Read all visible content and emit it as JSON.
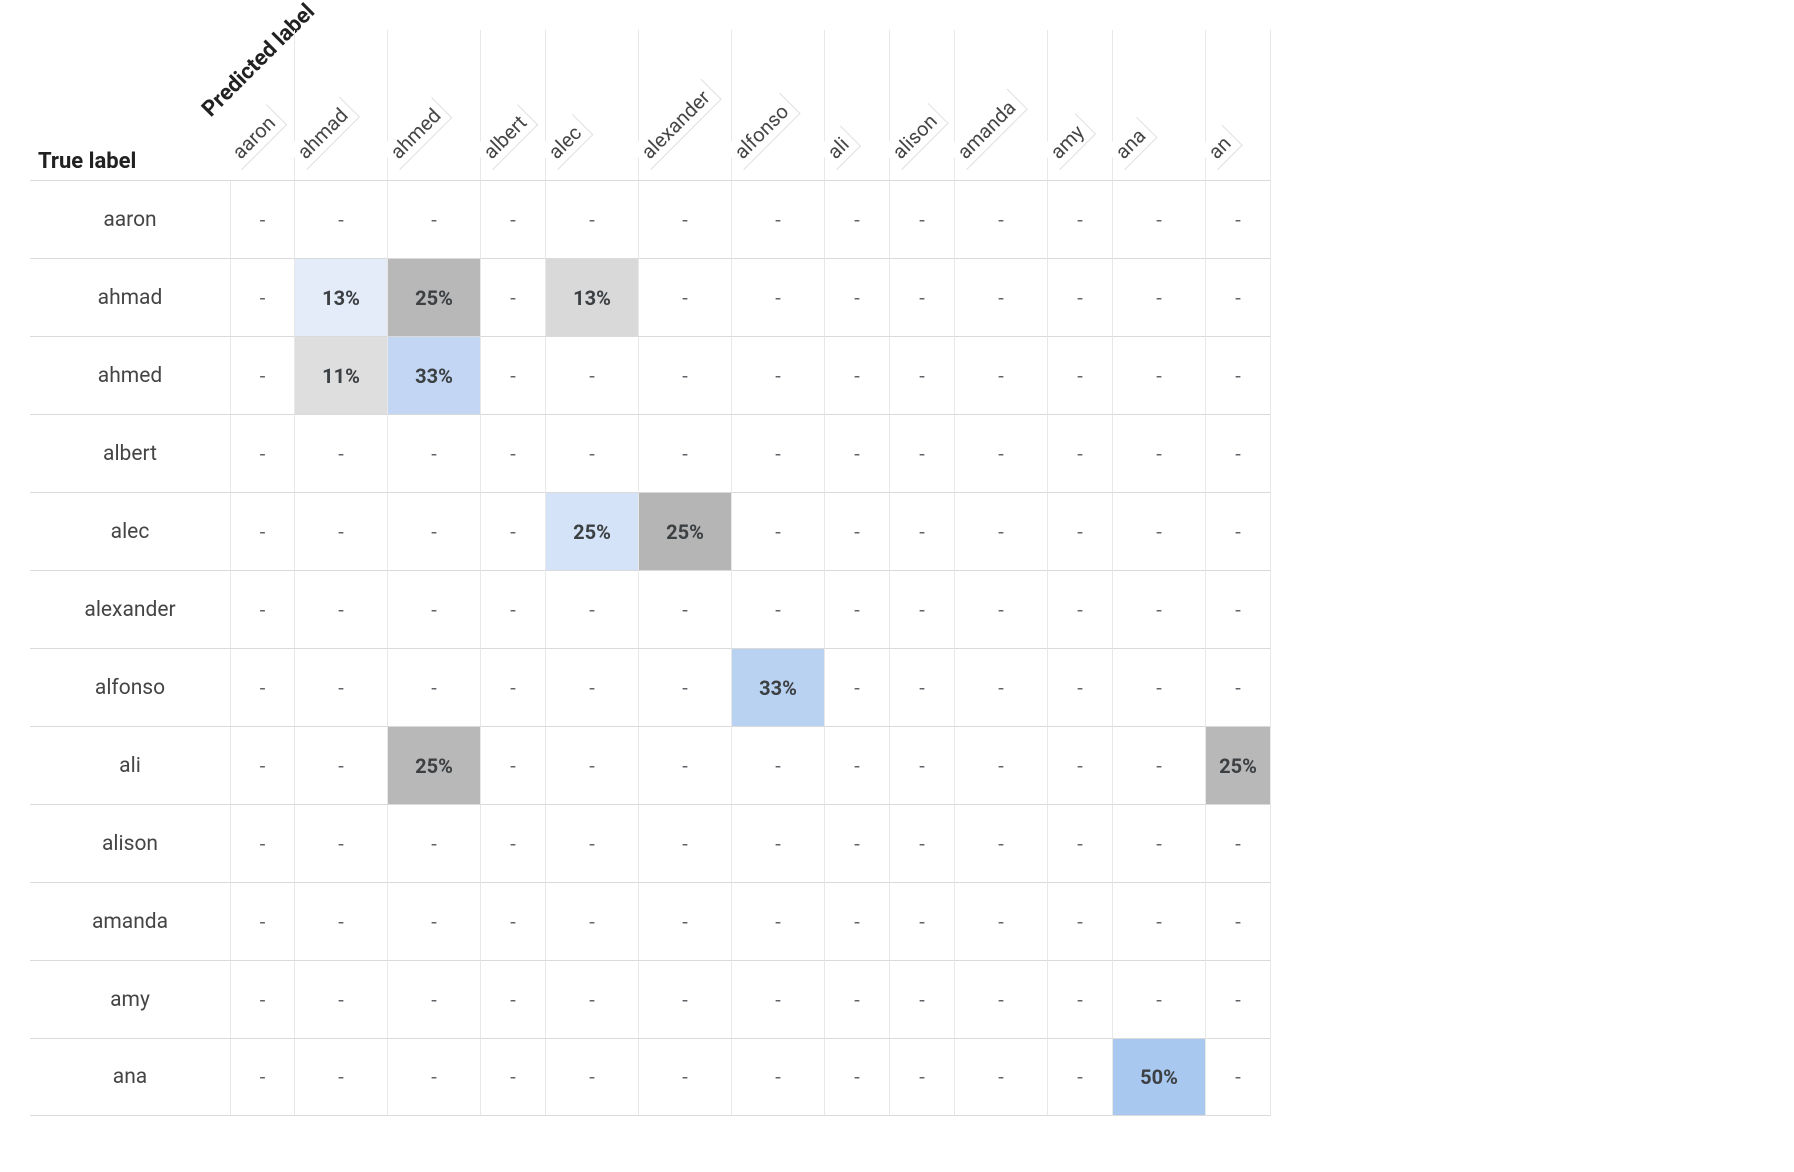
{
  "labels": {
    "true_label": "True label",
    "predicted_label": "Predicted label"
  },
  "columns": [
    "aaron",
    "ahmad",
    "ahmed",
    "albert",
    "alec",
    "alexander",
    "alfonso",
    "ali",
    "alison",
    "amanda",
    "amy",
    "ana",
    "an"
  ],
  "column_widths": [
    "n",
    "w",
    "w",
    "n",
    "w",
    "w",
    "w",
    "n",
    "n",
    "w",
    "n",
    "w",
    "n"
  ],
  "rows": [
    "aaron",
    "ahmad",
    "ahmed",
    "albert",
    "alec",
    "alexander",
    "alfonso",
    "ali",
    "alison",
    "amanda",
    "amy",
    "ana"
  ],
  "cells": {
    "ahmad": {
      "ahmad": {
        "v": "13%",
        "bg": "#e4ecfa"
      },
      "ahmed": {
        "v": "25%",
        "bg": "#b8b8b8"
      },
      "alec": {
        "v": "13%",
        "bg": "#d9d9d9"
      }
    },
    "ahmed": {
      "ahmad": {
        "v": "11%",
        "bg": "#dedede"
      },
      "ahmed": {
        "v": "33%",
        "bg": "#c3d7f5"
      }
    },
    "alec": {
      "alec": {
        "v": "25%",
        "bg": "#d5e3f8"
      },
      "alexander": {
        "v": "25%",
        "bg": "#b5b5b5"
      }
    },
    "alfonso": {
      "alfonso": {
        "v": "33%",
        "bg": "#b9d2f2"
      }
    },
    "ali": {
      "ahmed": {
        "v": "25%",
        "bg": "#b8b8b8"
      },
      "an": {
        "v": "25%",
        "bg": "#b8b8b8"
      }
    },
    "ana": {
      "ana": {
        "v": "50%",
        "bg": "#a9c8ef"
      }
    }
  },
  "chart_data": {
    "type": "heatmap",
    "title": "",
    "xlabel": "Predicted label",
    "ylabel": "True label",
    "x_categories": [
      "aaron",
      "ahmad",
      "ahmed",
      "albert",
      "alec",
      "alexander",
      "alfonso",
      "ali",
      "alison",
      "amanda",
      "amy",
      "ana"
    ],
    "y_categories": [
      "aaron",
      "ahmad",
      "ahmed",
      "albert",
      "alec",
      "alexander",
      "alfonso",
      "ali",
      "alison",
      "amanda",
      "amy",
      "ana"
    ],
    "value_unit": "percent",
    "values": [
      {
        "true": "ahmad",
        "predicted": "ahmad",
        "value": 13
      },
      {
        "true": "ahmad",
        "predicted": "ahmed",
        "value": 25
      },
      {
        "true": "ahmad",
        "predicted": "alec",
        "value": 13
      },
      {
        "true": "ahmed",
        "predicted": "ahmad",
        "value": 11
      },
      {
        "true": "ahmed",
        "predicted": "ahmed",
        "value": 33
      },
      {
        "true": "alec",
        "predicted": "alec",
        "value": 25
      },
      {
        "true": "alec",
        "predicted": "alexander",
        "value": 25
      },
      {
        "true": "alfonso",
        "predicted": "alfonso",
        "value": 33
      },
      {
        "true": "ali",
        "predicted": "ahmed",
        "value": 25
      },
      {
        "true": "ana",
        "predicted": "ana",
        "value": 50
      }
    ]
  }
}
